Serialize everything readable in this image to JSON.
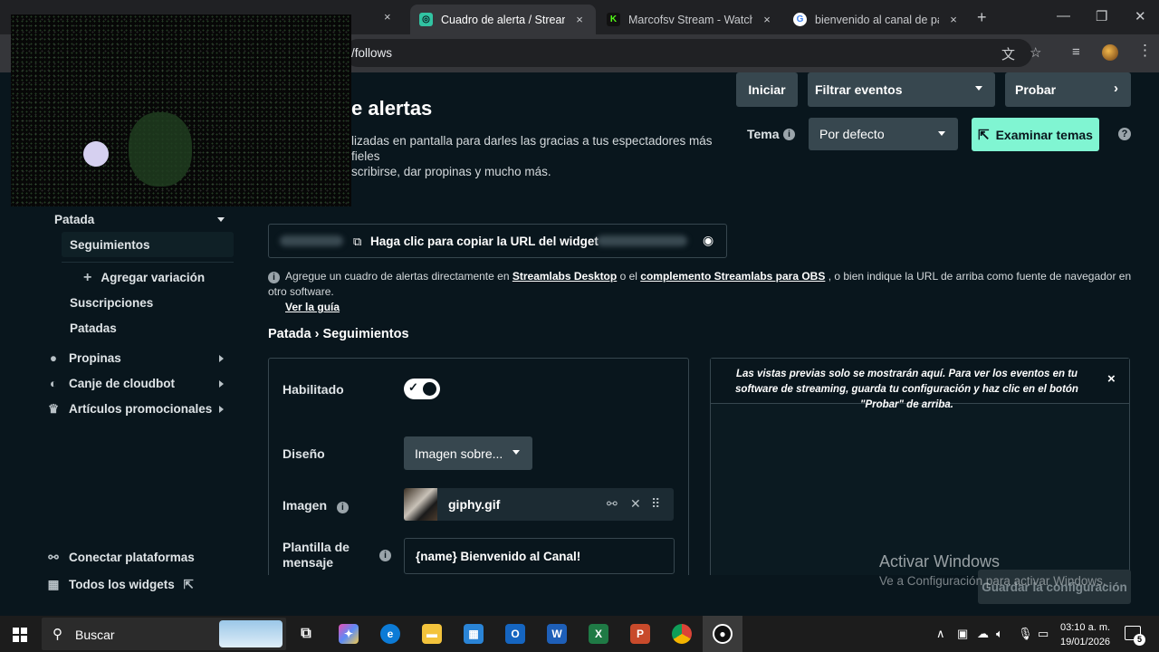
{
  "browser": {
    "tabs": [
      {
        "label": "Cuadro de alerta / Streamlabs",
        "close": "×"
      },
      {
        "label": "Marcofsv Stream - Watch Live",
        "close": "×"
      },
      {
        "label": "bienvenido al canal de panama",
        "close": "×"
      }
    ],
    "hidden_tab_close": "×",
    "new_tab": "+",
    "address": "/follows"
  },
  "header": {
    "title": "e alertas",
    "description_line1": "lizadas en pantalla para darles las gracias a tus espectadores más fieles",
    "description_line2": "scribirse, dar propinas y mucho más.",
    "tema_label": "Tema",
    "tema_value": "Por defecto",
    "explore_button": "Examinar temas",
    "help": "?"
  },
  "sidebar": {
    "section": "Patada",
    "active_item": "Seguimientos",
    "add_variation": "Agregar variación",
    "items": [
      "Suscripciones",
      "Patadas"
    ],
    "groups": [
      "Propinas",
      "Canje de cloudbot",
      "Artículos promocionales"
    ],
    "connect": "Conectar plataformas",
    "all_widgets": "Todos los widgets"
  },
  "url_row": {
    "copy_label": "Haga clic para copiar la URL del widget",
    "start": "Iniciar",
    "filter": "Filtrar eventos",
    "test": "Probar"
  },
  "info_line": {
    "prefix": "Agregue un cuadro de alertas directamente en",
    "link1": "Streamlabs Desktop",
    "middle": "o el",
    "link2": "complemento Streamlabs para OBS",
    "suffix": ", o bien indique la URL de arriba como fuente de navegador en otro software.",
    "guide": "Ver la guía"
  },
  "breadcrumb": {
    "parent": "Patada",
    "sep": "›",
    "current": "Seguimientos"
  },
  "form": {
    "enabled_label": "Habilitado",
    "design_label": "Diseño",
    "design_value": "Imagen sobre...",
    "image_label": "Imagen",
    "image_file": "giphy.gif",
    "template_label_line1": "Plantilla de",
    "template_label_line2": "mensaje",
    "template_value": "{name} Bienvenido al Canal!"
  },
  "preview": {
    "message": "Las vistas previas solo se mostrarán aquí. Para ver los eventos en tu software de streaming, guarda tu configuración y haz clic en el botón \"Probar\" de arriba.",
    "close": "×"
  },
  "save_button": "Guardar la configuración",
  "watermark": {
    "line1": "Activar Windows",
    "line2": "Ve a Configuración para activar Windows."
  },
  "taskbar": {
    "search_label": "Buscar",
    "time": "03:10 a. m.",
    "date": "19/01/2026",
    "notifications": "5"
  }
}
